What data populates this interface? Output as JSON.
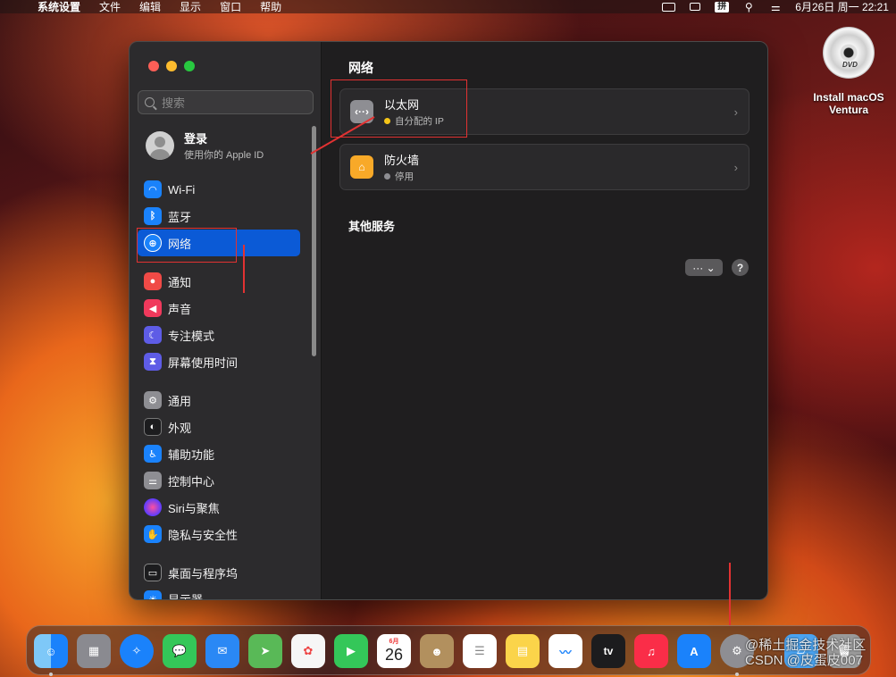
{
  "menubar": {
    "apple": "",
    "items": [
      "系统设置",
      "文件",
      "编辑",
      "显示",
      "窗口",
      "帮助"
    ],
    "input_method": "拼",
    "datetime": "6月26日 周一  22:21"
  },
  "desktop": {
    "dvd_label": "DVD",
    "dvd_name_line1": "Install macOS",
    "dvd_name_line2": "Ventura"
  },
  "sidebar": {
    "search_placeholder": "搜索",
    "account_title": "登录",
    "account_subtitle": "使用你的 Apple ID",
    "items": [
      {
        "label": "Wi-Fi",
        "icon": "wifi-icon",
        "color": "#1a82fb"
      },
      {
        "label": "蓝牙",
        "icon": "bluetooth-icon",
        "color": "#1a82fb"
      },
      {
        "label": "网络",
        "icon": "globe-icon",
        "color": "#1a82fb"
      },
      {
        "label": "通知",
        "icon": "bell-icon",
        "color": "#f04a46"
      },
      {
        "label": "声音",
        "icon": "speaker-icon",
        "color": "#f0395c"
      },
      {
        "label": "专注模式",
        "icon": "moon-icon",
        "color": "#5e5ce6"
      },
      {
        "label": "屏幕使用时间",
        "icon": "hourglass-icon",
        "color": "#5e5ce6"
      },
      {
        "label": "通用",
        "icon": "gear-icon",
        "color": "#8e8e93"
      },
      {
        "label": "外观",
        "icon": "appearance-icon",
        "color": "#1c1c1e"
      },
      {
        "label": "辅助功能",
        "icon": "accessibility-icon",
        "color": "#1a82fb"
      },
      {
        "label": "控制中心",
        "icon": "control-center-icon",
        "color": "#8e8e93"
      },
      {
        "label": "Siri与聚焦",
        "icon": "siri-icon",
        "color": "#c03ec9"
      },
      {
        "label": "隐私与安全性",
        "icon": "hand-icon",
        "color": "#1a82fb"
      },
      {
        "label": "桌面与程序坞",
        "icon": "dock-icon",
        "color": "#1c1c1e"
      },
      {
        "label": "显示器",
        "icon": "display-icon",
        "color": "#1a82fb"
      }
    ]
  },
  "main": {
    "title": "网络",
    "ethernet_title": "以太网",
    "ethernet_status": "自分配的 IP",
    "ethernet_status_color": "#f5c518",
    "firewall_title": "防火墙",
    "firewall_status": "停用",
    "firewall_status_color": "#8e8e93",
    "other_services": "其他服务",
    "more_button": "··· ⌄",
    "help_button": "?"
  },
  "dock": {
    "apps": [
      {
        "name": "finder",
        "color": "#2f8bf0"
      },
      {
        "name": "launchpad",
        "color": "#8a8a90"
      },
      {
        "name": "safari",
        "color": "#1a82fb"
      },
      {
        "name": "messages",
        "color": "#34c759"
      },
      {
        "name": "mail",
        "color": "#2a88f5"
      },
      {
        "name": "maps",
        "color": "#59b957"
      },
      {
        "name": "photos",
        "color": "#f6f6f6"
      },
      {
        "name": "facetime",
        "color": "#34c759"
      },
      {
        "name": "calendar",
        "color": "#ffffff"
      },
      {
        "name": "contacts",
        "color": "#b2905e"
      },
      {
        "name": "reminders",
        "color": "#ffffff"
      },
      {
        "name": "notes",
        "color": "#fbd44a"
      },
      {
        "name": "freeform",
        "color": "#ffffff"
      },
      {
        "name": "tv",
        "color": "#1c1c1e"
      },
      {
        "name": "music",
        "color": "#fa2d48"
      },
      {
        "name": "app-store",
        "color": "#1a82fb"
      },
      {
        "name": "system-settings",
        "color": "#8e8e93"
      },
      {
        "name": "downloads-folder",
        "color": "#4aa3f0"
      },
      {
        "name": "trash",
        "color": "#9a9a9a"
      }
    ],
    "calendar_month": "6月",
    "calendar_day": "26",
    "tv_label": "tv"
  },
  "watermark": {
    "line1": "@稀土掘金技术社区",
    "line2": "CSDN @皮蛋皮007"
  }
}
